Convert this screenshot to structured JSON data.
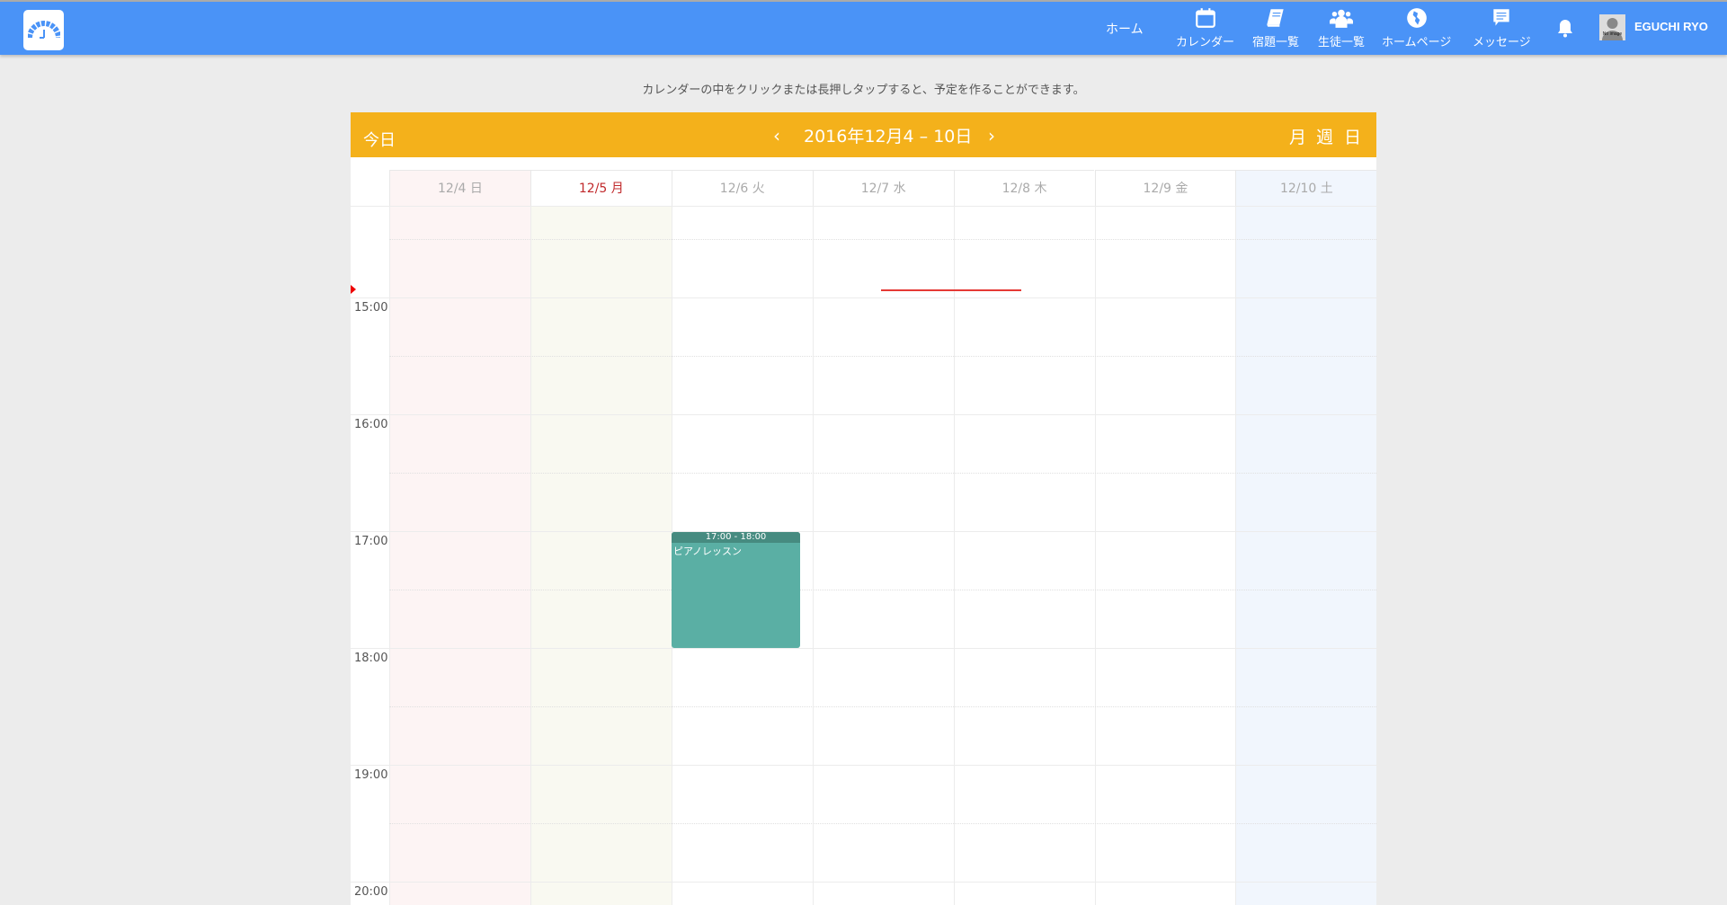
{
  "header": {
    "nav": [
      {
        "label": "ホーム",
        "icon": "home"
      },
      {
        "label": "カレンダー",
        "icon": "calendar-icon"
      },
      {
        "label": "宿題一覧",
        "icon": "book-icon"
      },
      {
        "label": "生徒一覧",
        "icon": "users-icon"
      },
      {
        "label": "ホームページ",
        "icon": "globe-icon"
      },
      {
        "label": "メッセージ",
        "icon": "message-icon"
      }
    ],
    "user": "EGUCHI RYO",
    "avatar_text": "No image"
  },
  "hint": "カレンダーの中をクリックまたは長押しタップすると、予定を作ることができます。",
  "calendar": {
    "today_label": "今日",
    "prev": "‹",
    "next": "›",
    "range": "2016年12月4 – 10日",
    "views": [
      "月",
      "週",
      "日"
    ],
    "days": [
      "12/4 日",
      "12/5 月",
      "12/6 火",
      "12/7 水",
      "12/8 木",
      "12/9 金",
      "12/10 土"
    ],
    "hours": [
      "15:00",
      "16:00",
      "17:00",
      "18:00",
      "19:00",
      "20:00"
    ],
    "events": [
      {
        "time": "17:00 - 18:00",
        "title": "ピアノレッスン",
        "day": "12/6 火",
        "color": "#5aafa4"
      }
    ],
    "colors": {
      "toolbar": "#f4b11b",
      "sunday": "#fdf4f4",
      "today": "#f9f9f1",
      "saturday": "#f1f6fd",
      "today_text": "#c0292b"
    }
  }
}
